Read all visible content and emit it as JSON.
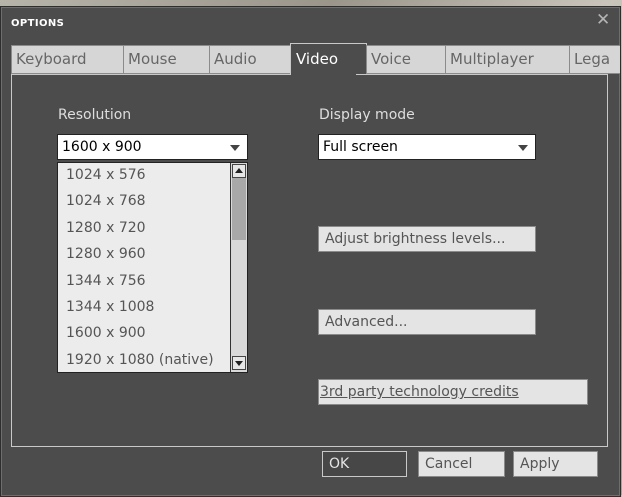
{
  "window": {
    "title": "OPTIONS",
    "close_glyph": "✕"
  },
  "tabs": [
    {
      "label": "Keyboard",
      "active": false
    },
    {
      "label": "Mouse",
      "active": false
    },
    {
      "label": "Audio",
      "active": false
    },
    {
      "label": "Video",
      "active": true
    },
    {
      "label": "Voice",
      "active": false
    },
    {
      "label": "Multiplayer",
      "active": false
    },
    {
      "label": "Lega",
      "active": false
    }
  ],
  "video": {
    "resolution_label": "Resolution",
    "resolution_value": "1600 x 900",
    "resolution_options": [
      "1024 x 576",
      "1024 x 768",
      "1280 x 720",
      "1280 x 960",
      "1344 x 756",
      "1344 x 1008",
      "1600 x 900",
      "1920 x 1080 (native)"
    ],
    "display_mode_label": "Display mode",
    "display_mode_value": "Full screen",
    "brightness_button": "Adjust brightness levels...",
    "advanced_button": "Advanced...",
    "credits_button": "3rd party technology credits"
  },
  "footer": {
    "ok": "OK",
    "cancel": "Cancel",
    "apply": "Apply"
  },
  "colors": {
    "dialog_bg": "#4c4c4c",
    "tab_bg": "#d6d6d6",
    "list_bg": "#ececec"
  }
}
